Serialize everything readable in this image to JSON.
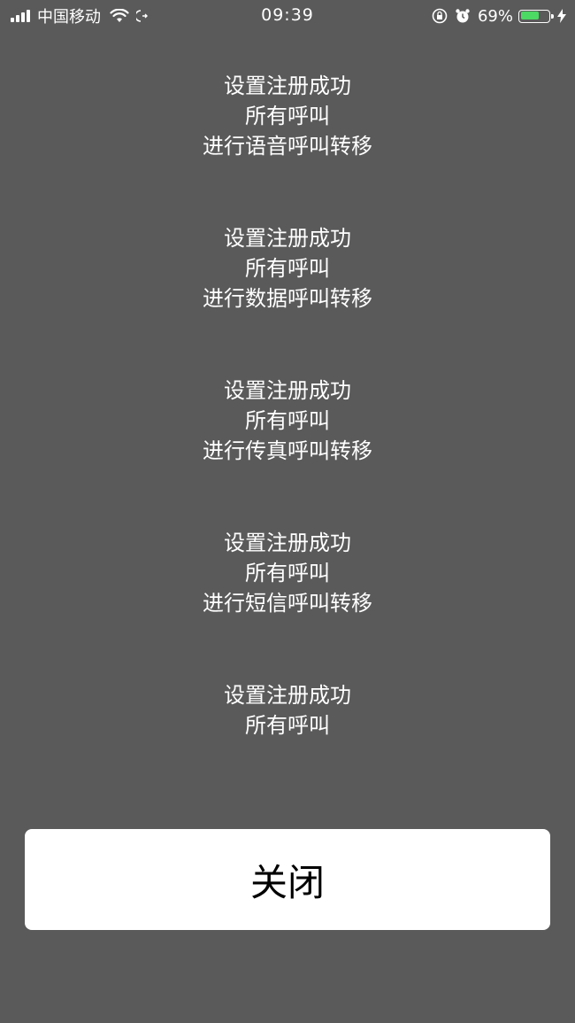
{
  "status_bar": {
    "carrier": "中国移动",
    "time": "09:39",
    "battery_percent": "69%",
    "battery_level": 0.69,
    "battery_color": "#4cd964",
    "icons": [
      "signal-icon",
      "wifi-icon",
      "call-forward-icon",
      "orientation-lock-icon",
      "alarm-icon",
      "battery-icon",
      "charging-bolt-icon"
    ]
  },
  "messages": [
    {
      "line1": "设置注册成功",
      "line2": "所有呼叫",
      "line3": "进行语音呼叫转移"
    },
    {
      "line1": "设置注册成功",
      "line2": "所有呼叫",
      "line3": "进行数据呼叫转移"
    },
    {
      "line1": "设置注册成功",
      "line2": "所有呼叫",
      "line3": "进行传真呼叫转移"
    },
    {
      "line1": "设置注册成功",
      "line2": "所有呼叫",
      "line3": "进行短信呼叫转移"
    },
    {
      "line1": "设置注册成功",
      "line2": "所有呼叫",
      "line3": ""
    }
  ],
  "close_button": {
    "label": "关闭"
  },
  "colors": {
    "background": "#5a5a5a",
    "button_bg": "#ffffff",
    "text": "#ffffff"
  }
}
